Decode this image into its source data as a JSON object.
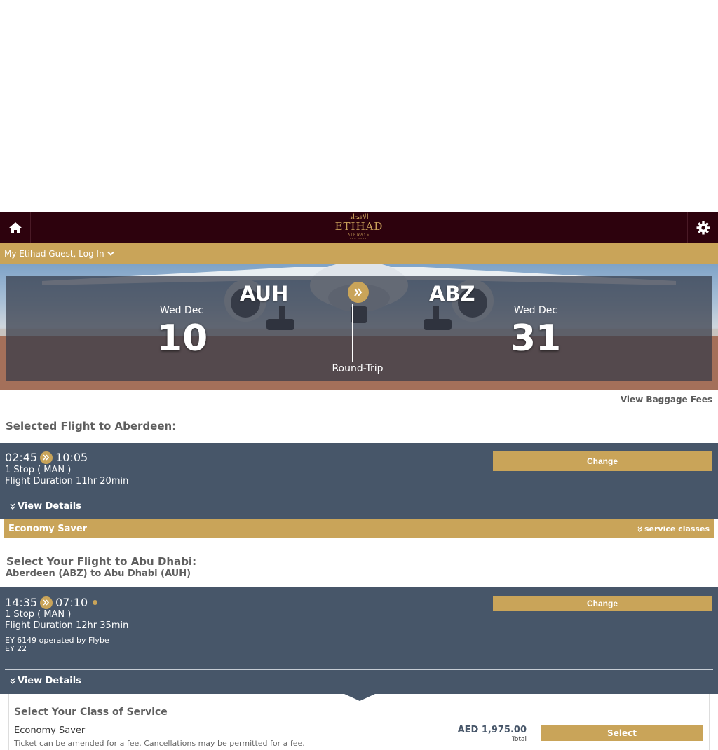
{
  "nav": {
    "home_icon": "home-icon",
    "settings_icon": "gear-icon",
    "logo": {
      "arabic": "الاتحاد",
      "main": "ETIHAD",
      "sub": "AIRWAYS",
      "city": "ABU DHABI"
    }
  },
  "login": {
    "label": "My Etihad Guest, Log In"
  },
  "hero": {
    "origin_code": "AUH",
    "destination_code": "ABZ",
    "depart_dow": "Wed Dec",
    "depart_day": "10",
    "return_dow": "Wed Dec",
    "return_day": "31",
    "trip_type": "Round-Trip"
  },
  "baggage_link": "View Baggage Fees",
  "outbound": {
    "section_title": "Selected Flight to Aberdeen:",
    "depart_time": "02:45",
    "arrive_time": "10:05",
    "stops": "1 Stop ( MAN )",
    "duration": "Flight Duration 11hr 20min",
    "change_label": "Change",
    "view_details": "View Details",
    "fare_class": "Economy Saver",
    "service_classes": "service classes"
  },
  "inbound": {
    "section_title": "Select Your Flight to Abu Dhabi:",
    "route": "Aberdeen (ABZ) to Abu Dhabi (AUH)",
    "depart_time": "14:35",
    "arrive_time": "07:10",
    "stops": "1 Stop ( MAN )",
    "duration": "Flight Duration 12hr 35min",
    "flight_1": "EY 6149 operated by Flybe",
    "flight_2": "EY 22",
    "change_label": "Change",
    "view_details": "View Details"
  },
  "class_of_service": {
    "title": "Select Your Class of Service",
    "name": "Economy Saver",
    "description": "Ticket can be amended for a fee. Cancellations may be permitted for a fee.",
    "price": "AED 1,975.00",
    "price_label": "Total",
    "select_label": "Select"
  },
  "colors": {
    "navbar": "#2d020d",
    "gold": "#c9a459",
    "flight_box": "#475669"
  }
}
